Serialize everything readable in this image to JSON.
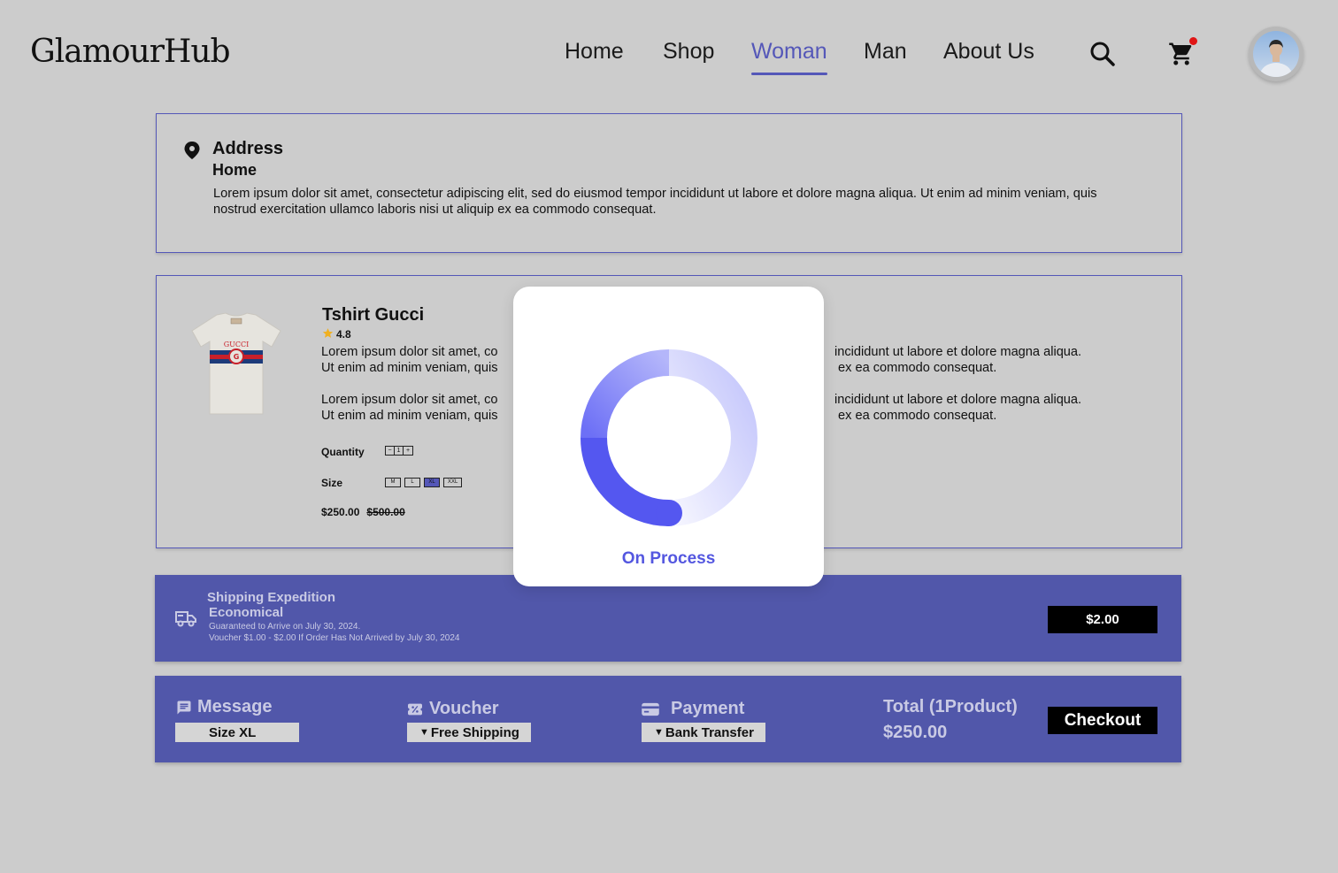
{
  "brand": {
    "logo": "GlamourHub"
  },
  "nav": {
    "items": [
      {
        "label": "Home",
        "active": false
      },
      {
        "label": "Shop",
        "active": false
      },
      {
        "label": "Woman",
        "active": true
      },
      {
        "label": "Man",
        "active": false
      },
      {
        "label": "About Us",
        "active": false
      }
    ],
    "accent_color": "#5457b8",
    "cart_badge_color": "#e01515"
  },
  "address": {
    "title": "Address",
    "label": "Home",
    "text": "Lorem ipsum dolor sit amet, consectetur adipiscing elit, sed do eiusmod tempor incididunt ut labore et dolore magna aliqua. Ut enim ad minim veniam, quis nostrud exercitation ullamco laboris nisi ut aliquip ex ea commodo consequat."
  },
  "product": {
    "name": "Tshirt Gucci",
    "rating": "4.8",
    "desc1_line1": "Lorem ipsum dolor sit amet, co",
    "desc1_line2": "Ut enim ad minim veniam, quis",
    "desc1_right1": "incididunt ut labore et dolore magna aliqua.",
    "desc1_right2": "ex ea commodo consequat.",
    "desc2_line1": "Lorem ipsum dolor sit amet, co",
    "desc2_line2": "Ut enim ad minim veniam, quis",
    "desc2_right1": "incididunt ut labore et dolore magna aliqua.",
    "desc2_right2": "ex ea commodo consequat.",
    "quantity_label": "Quantity",
    "quantity": {
      "minus": "−",
      "value": "1",
      "plus": "+"
    },
    "size_label": "Size",
    "sizes": [
      "M",
      "L",
      "XL",
      "XXL"
    ],
    "selected_size": "XL",
    "price": "$250.00",
    "original_price": "$500.00",
    "brand_print": "GUCCI"
  },
  "shipping": {
    "title": "Shipping Expedition",
    "type": "Economical",
    "note1": "Guaranteed to Arrive on July 30, 2024.",
    "note2": "Voucher $1.00 - $2.00 If Order Has Not Arrived by July 30, 2024",
    "price": "$2.00"
  },
  "checkout_bar": {
    "message_label": "Message",
    "message_value": "Size XL",
    "voucher_label": "Voucher",
    "voucher_value": "Free Shipping",
    "payment_label": "Payment",
    "payment_value": "Bank Transfer",
    "total_label": "Total (1Product)",
    "total_value": "$250.00",
    "checkout_label": "Checkout",
    "bar_color": "#5157aa"
  },
  "modal": {
    "status": "On Process",
    "spinner_color": "#5457f0"
  }
}
